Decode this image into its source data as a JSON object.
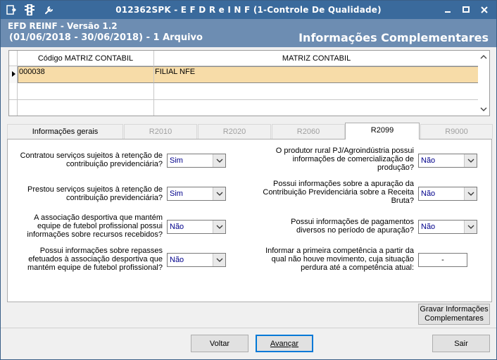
{
  "window": {
    "title": "012362SPK - E F D  R e I N F (1-Controle De Qualidade)",
    "icons": [
      "app-menu-icon",
      "traffic-light-icon",
      "wrench-icon"
    ],
    "controls": [
      "minimize-icon",
      "maximize-icon",
      "close-icon"
    ]
  },
  "header": {
    "line1": "EFD REINF - Versão 1.2",
    "line2": "(01/06/2018 - 30/06/2018) - 1 Arquivo",
    "title": "Informações Complementares"
  },
  "grid": {
    "columns": [
      "Código MATRIZ CONTABIL",
      "MATRIZ CONTABIL"
    ],
    "rows": [
      {
        "codigo": "000038",
        "matriz": "FILIAL NFE"
      }
    ]
  },
  "tabs": [
    {
      "label": "Informações gerais",
      "state": "enabled"
    },
    {
      "label": "R2010",
      "state": "disabled"
    },
    {
      "label": "R2020",
      "state": "disabled"
    },
    {
      "label": "R2060",
      "state": "disabled"
    },
    {
      "label": "R2099",
      "state": "active"
    },
    {
      "label": "R9000",
      "state": "disabled"
    }
  ],
  "form": {
    "left": [
      {
        "question": "Contratou serviços sujeitos à retenção de contribuição previdenciária?",
        "value": "Sim"
      },
      {
        "question": "Prestou serviços sujeitos à retenção de contribuição previdenciária?",
        "value": "Sim"
      },
      {
        "question": "A associação desportiva que mantém equipe de futebol profissional possui informações sobre recursos recebidos?",
        "value": "Não"
      },
      {
        "question": "Possui informações sobre repasses efetuados à associação desportiva que mantém equipe de futebol profissional?",
        "value": "Não"
      }
    ],
    "right": [
      {
        "question": "O produtor rural PJ/Agroindústria possui informações de comercialização de produção?",
        "value": "Não"
      },
      {
        "question": "Possui informações sobre a apuração da Contribuição Previdenciária sobre a Receita Bruta?",
        "value": "Não"
      },
      {
        "question": "Possui informações de pagamentos diversos no período de apuração?",
        "value": "Não"
      },
      {
        "question": "Informar a primeira competência a partir da qual não houve movimento, cuja situação perdura até a competência atual:",
        "value": "-"
      }
    ]
  },
  "buttons": {
    "save_line1": "Gravar Informações",
    "save_line2": "Complementares",
    "back": "Voltar",
    "next": "Avançar",
    "exit": "Sair"
  },
  "colors": {
    "titlebar": "#3a6a9c",
    "header": "#6d8db2",
    "selected_row": "#f7dca8",
    "combo_text": "#00008b"
  }
}
